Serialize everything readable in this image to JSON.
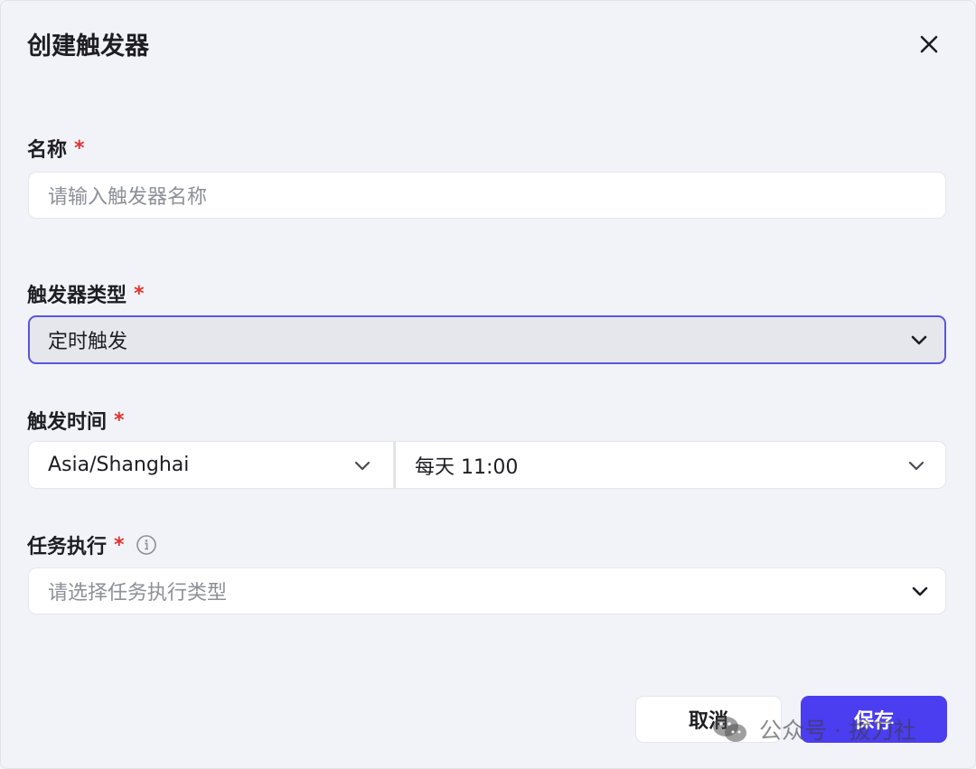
{
  "dialog": {
    "title": "创建触发器",
    "close_icon": "close-icon"
  },
  "fields": {
    "name": {
      "label": "名称",
      "required_mark": "*",
      "placeholder": "请输入触发器名称",
      "value": ""
    },
    "trigger_type": {
      "label": "触发器类型",
      "required_mark": "*",
      "selected": "定时触发",
      "icon": "chevron-down-icon"
    },
    "trigger_time": {
      "label": "触发时间",
      "required_mark": "*",
      "timezone": "Asia/Shanghai",
      "schedule": "每天 11:00",
      "icon": "chevron-down-icon"
    },
    "task_exec": {
      "label": "任务执行",
      "required_mark": "*",
      "info_icon": "info-icon",
      "placeholder": "请选择任务执行类型",
      "icon": "chevron-down-icon"
    }
  },
  "actions": {
    "cancel_label": "取消",
    "save_label": "保存"
  },
  "watermark": {
    "text": "公众号 · 拔刀社",
    "icon": "wechat-icon"
  },
  "colors": {
    "background": "#f2f3f8",
    "accent": "#4b3df0",
    "focus_border": "#5b55dd",
    "required": "#e5322d"
  }
}
